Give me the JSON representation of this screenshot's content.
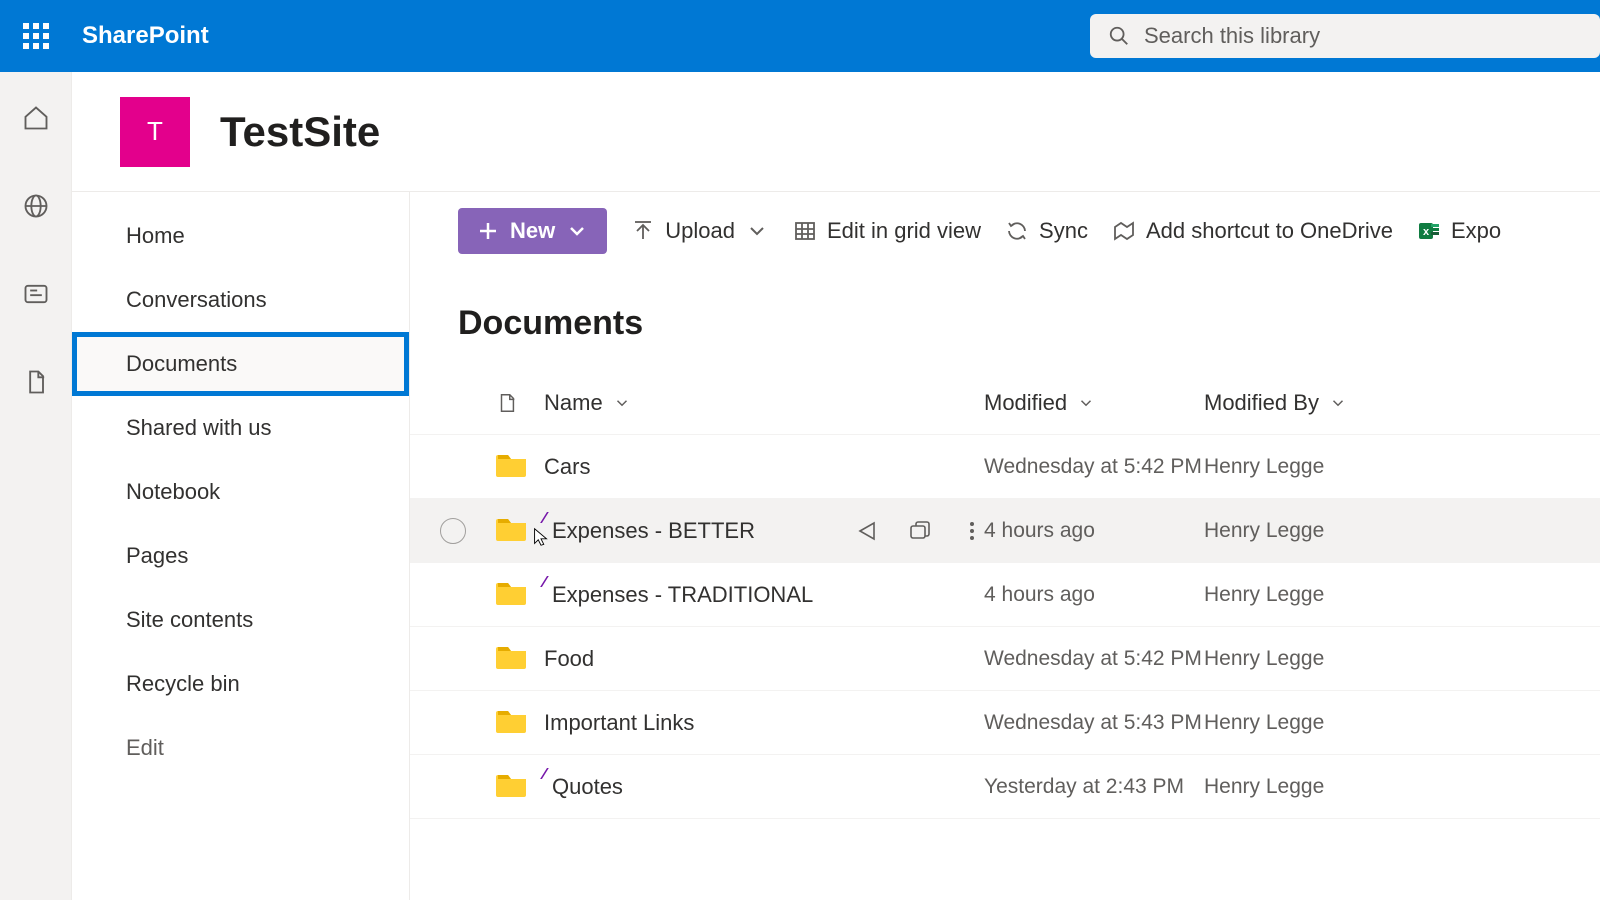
{
  "suite": {
    "title": "SharePoint",
    "search_placeholder": "Search this library"
  },
  "site": {
    "logo_letter": "T",
    "name": "TestSite"
  },
  "nav": {
    "items": [
      {
        "label": "Home"
      },
      {
        "label": "Conversations"
      },
      {
        "label": "Documents"
      },
      {
        "label": "Shared with us"
      },
      {
        "label": "Notebook"
      },
      {
        "label": "Pages"
      },
      {
        "label": "Site contents"
      },
      {
        "label": "Recycle bin"
      }
    ],
    "edit_label": "Edit",
    "selected_index": 2
  },
  "cmdbar": {
    "new": "New",
    "upload": "Upload",
    "grid": "Edit in grid view",
    "sync": "Sync",
    "shortcut": "Add shortcut to OneDrive",
    "export": "Expo"
  },
  "library": {
    "title": "Documents",
    "columns": {
      "name": "Name",
      "modified": "Modified",
      "modified_by": "Modified By"
    },
    "rows": [
      {
        "name": "Cars",
        "modified": "Wednesday at 5:42 PM",
        "by": "Henry Legge",
        "is_new": false
      },
      {
        "name": "Expenses - BETTER",
        "modified": "4 hours ago",
        "by": "Henry Legge",
        "is_new": true
      },
      {
        "name": "Expenses - TRADITIONAL",
        "modified": "4 hours ago",
        "by": "Henry Legge",
        "is_new": true
      },
      {
        "name": "Food",
        "modified": "Wednesday at 5:42 PM",
        "by": "Henry Legge",
        "is_new": false
      },
      {
        "name": "Important Links",
        "modified": "Wednesday at 5:43 PM",
        "by": "Henry Legge",
        "is_new": false
      },
      {
        "name": "Quotes",
        "modified": "Yesterday at 2:43 PM",
        "by": "Henry Legge",
        "is_new": true
      }
    ],
    "hover_index": 1
  }
}
